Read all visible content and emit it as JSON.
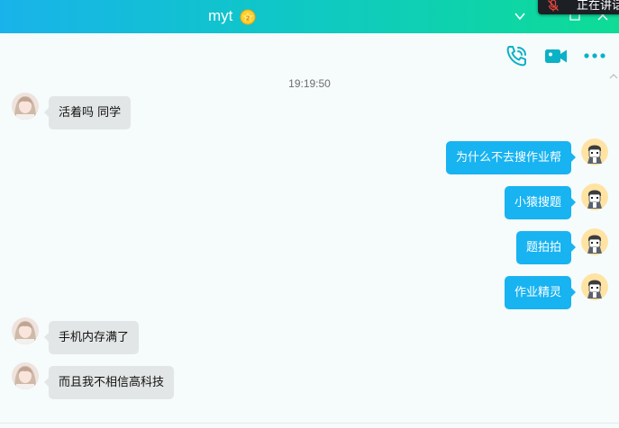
{
  "window": {
    "title": "myt",
    "badge_icon": "vip-badge-icon",
    "title_color": "#ffffff",
    "gradient": [
      "#19b3ea",
      "#0edc96"
    ]
  },
  "overlay": {
    "speaking_label": "正在讲话",
    "icon": "mic-off-icon"
  },
  "toolbar": {
    "icons": [
      "voice-call-icon",
      "video-call-icon",
      "more-icon"
    ],
    "accent": "#0ab1c7"
  },
  "chat": {
    "timestamp": "19:19:50",
    "incoming_color": "#e3e6e6",
    "outgoing_color": "#18b3f1",
    "messages": [
      {
        "side": "in",
        "text": "活着吗 同学"
      },
      {
        "side": "out",
        "text": "为什么不去搜作业帮"
      },
      {
        "side": "out",
        "text": "小猿搜题"
      },
      {
        "side": "out",
        "text": "题拍拍"
      },
      {
        "side": "out",
        "text": "作业精灵"
      },
      {
        "side": "in",
        "text": "手机内存满了"
      },
      {
        "side": "in",
        "text": "而且我不相信高科技"
      }
    ]
  }
}
